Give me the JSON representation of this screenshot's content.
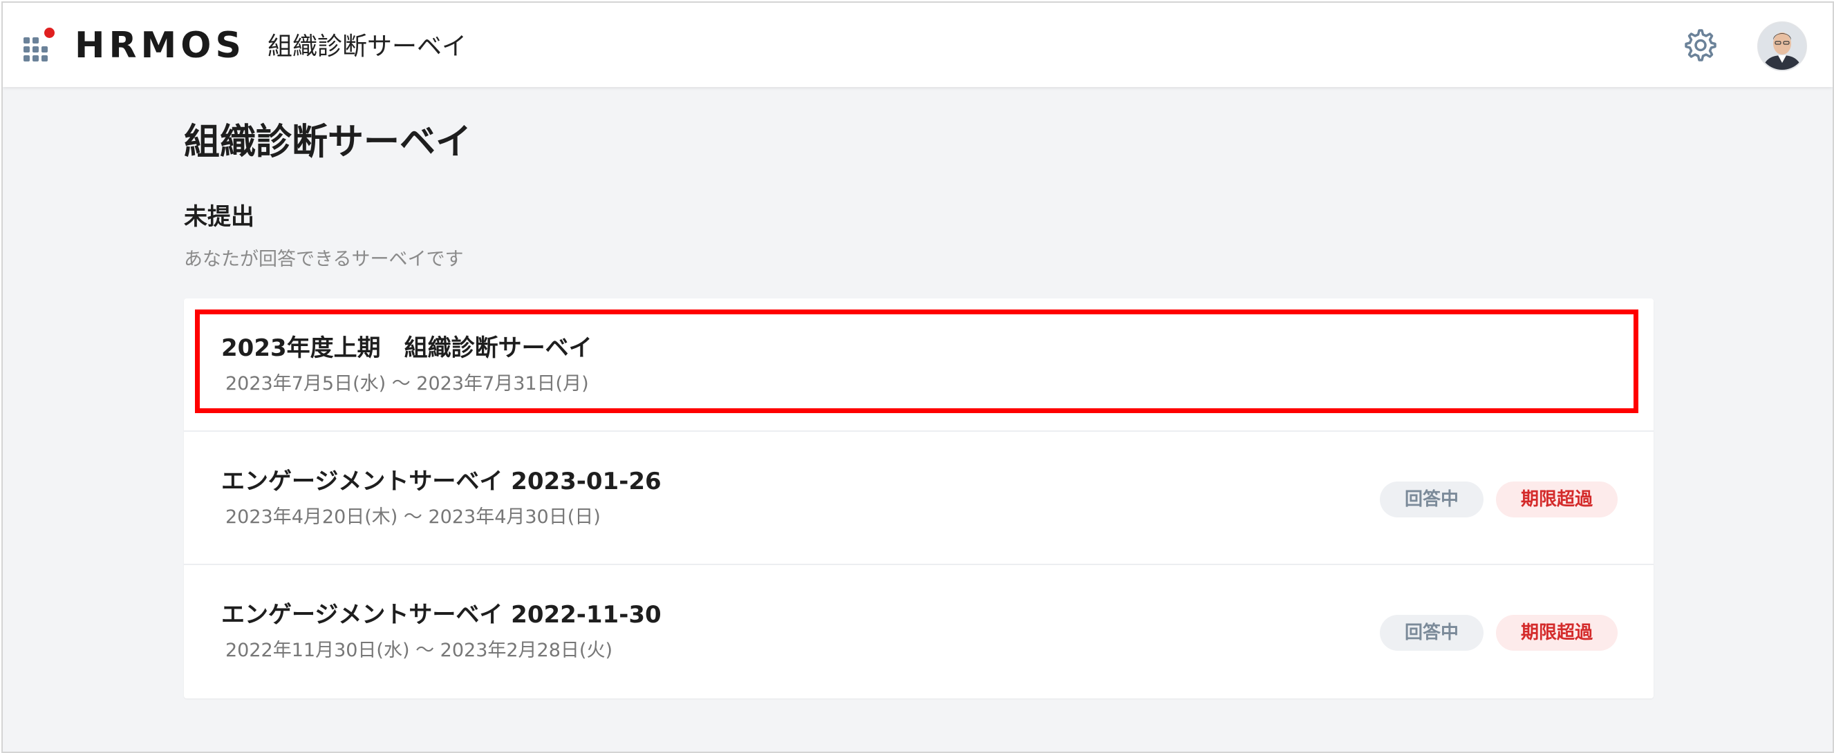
{
  "header": {
    "logo_text": "HRMOS",
    "app_name": "組織診断サーベイ",
    "apps_icon": "apps-grid-icon",
    "settings_icon": "gear-icon",
    "avatar": "user-avatar"
  },
  "main": {
    "title": "組織診断サーベイ",
    "section": {
      "title": "未提出",
      "subtitle": "あなたが回答できるサーベイです"
    },
    "surveys": [
      {
        "title": "2023年度上期　組織診断サーベイ",
        "period": "2023年7月5日(水) 〜 2023年7月31日(月)",
        "highlighted": true
      },
      {
        "title": "エンゲージメントサーベイ 2023-01-26",
        "period": "2023年4月20日(木) 〜 2023年4月30日(日)",
        "status_badge": "回答中",
        "overdue_badge": "期限超過"
      },
      {
        "title": "エンゲージメントサーベイ 2022-11-30",
        "period": "2022年11月30日(水) 〜 2023年2月28日(火)",
        "status_badge": "回答中",
        "overdue_badge": "期限超過"
      }
    ]
  },
  "colors": {
    "background": "#f3f4f6",
    "highlight_border": "#ff0000",
    "overdue_text": "#d42b2b",
    "overdue_bg": "#fdebeb",
    "status_text": "#7b8a99",
    "status_bg": "#eef0f3",
    "logo_accent": "#e02020"
  }
}
